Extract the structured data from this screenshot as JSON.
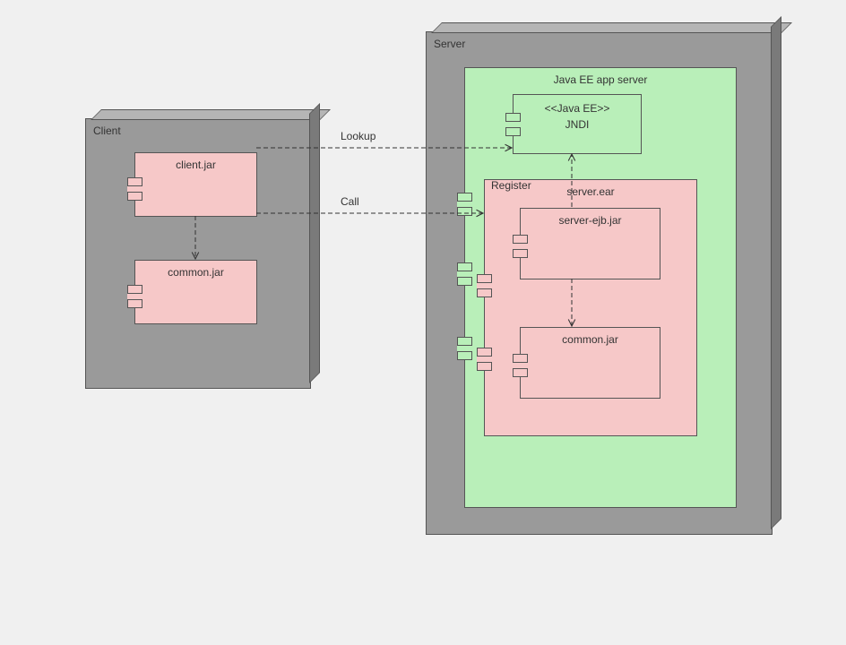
{
  "nodes": {
    "client": {
      "label": "Client"
    },
    "server": {
      "label": "Server"
    },
    "appserver": {
      "label": "Java EE app server"
    }
  },
  "components": {
    "client_jar": {
      "label": "client.jar"
    },
    "client_common_jar": {
      "label": "common.jar"
    },
    "jndi_stereotype": "<<Java EE>>",
    "jndi": {
      "label": "JNDI"
    },
    "server_ear": {
      "label": "server.ear"
    },
    "server_ejb_jar": {
      "label": "server-ejb.jar"
    },
    "server_common_jar": {
      "label": "common.jar"
    }
  },
  "connectors": {
    "lookup": {
      "label": "Lookup"
    },
    "call": {
      "label": "Call"
    },
    "register": {
      "label": "Register"
    }
  }
}
